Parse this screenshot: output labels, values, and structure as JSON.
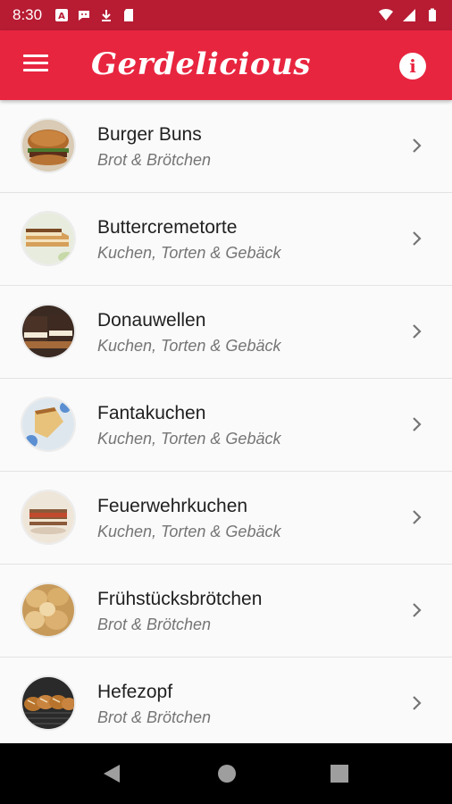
{
  "status_bar": {
    "time": "8:30",
    "left_icons": [
      "a-box-icon",
      "message-icon",
      "download-icon",
      "sd-card-icon"
    ],
    "right_icons": [
      "wifi-icon",
      "signal-icon",
      "battery-icon"
    ]
  },
  "app_bar": {
    "title": "Gerdelicious",
    "menu_icon": "menu-icon",
    "info_icon": "info-icon",
    "info_glyph": "i",
    "background": "#e8253f"
  },
  "recipes": [
    {
      "name": "Burger Buns",
      "category": "Brot & Brötchen",
      "thumb": "burger"
    },
    {
      "name": "Buttercremetorte",
      "category": "Kuchen, Torten & Gebäck",
      "thumb": "cake-slice"
    },
    {
      "name": "Donauwellen",
      "category": "Kuchen, Torten & Gebäck",
      "thumb": "donauwellen"
    },
    {
      "name": "Fantakuchen",
      "category": "Kuchen, Torten & Gebäck",
      "thumb": "fantakuchen"
    },
    {
      "name": "Feuerwehrkuchen",
      "category": "Kuchen, Torten & Gebäck",
      "thumb": "feuerwehr"
    },
    {
      "name": "Frühstücksbrötchen",
      "category": "Brot & Brötchen",
      "thumb": "rolls"
    },
    {
      "name": "Hefezopf",
      "category": "Brot & Brötchen",
      "thumb": "hefezopf"
    }
  ],
  "nav_bar": {
    "back_icon": "back-triangle-icon",
    "home_icon": "home-circle-icon",
    "recents_icon": "recents-square-icon"
  }
}
